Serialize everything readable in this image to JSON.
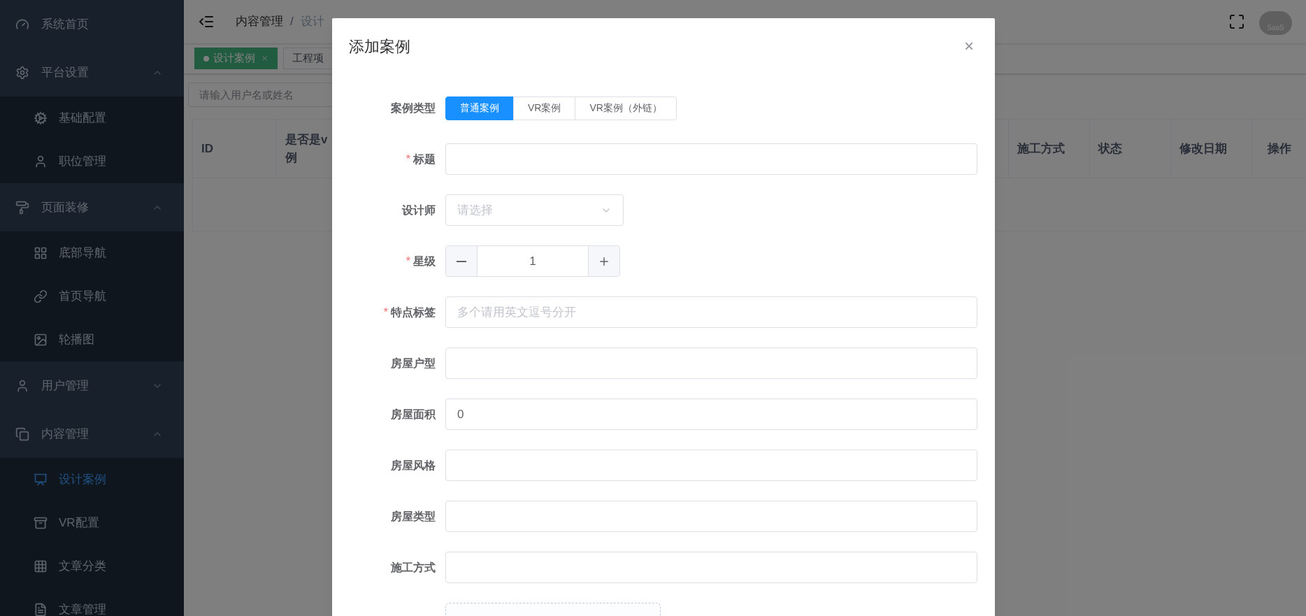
{
  "sidebar": {
    "items": [
      {
        "label": "系统首页",
        "kind": "link",
        "selected": false
      },
      {
        "label": "平台设置",
        "kind": "group",
        "expanded": true,
        "children": [
          {
            "label": "基础配置",
            "selected": false
          },
          {
            "label": "职位管理",
            "selected": false
          }
        ]
      },
      {
        "label": "页面装修",
        "kind": "group",
        "expanded": true,
        "children": [
          {
            "label": "底部导航",
            "selected": false
          },
          {
            "label": "首页导航",
            "selected": false
          },
          {
            "label": "轮播图",
            "selected": false
          }
        ]
      },
      {
        "label": "用户管理",
        "kind": "group",
        "expanded": false
      },
      {
        "label": "内容管理",
        "kind": "group",
        "expanded": true,
        "children": [
          {
            "label": "设计案例",
            "selected": true
          },
          {
            "label": "VR配置",
            "selected": false
          },
          {
            "label": "文章分类",
            "selected": false
          },
          {
            "label": "文章管理",
            "selected": false
          }
        ]
      }
    ]
  },
  "header": {
    "breadcrumb": [
      "内容管理",
      "设计"
    ],
    "separator": "/",
    "avatar_text": "SaaS"
  },
  "tags": [
    {
      "label": "设计案例",
      "selected": true
    },
    {
      "label": "工程项",
      "selected": false
    }
  ],
  "search": {
    "placeholder": "请输入用户名或姓名"
  },
  "table": {
    "columns": [
      {
        "lines": [
          "ID"
        ]
      },
      {
        "lines": [
          "是否是v",
          "例"
        ]
      },
      {
        "lines": [
          "施工方式"
        ]
      },
      {
        "lines": [
          "状态"
        ]
      },
      {
        "lines": [
          "修改日期"
        ]
      },
      {
        "lines": [
          "操作"
        ]
      }
    ]
  },
  "dialog": {
    "title": "添加案例",
    "close": "×",
    "required_mark": "*",
    "fields": [
      {
        "kind": "radio",
        "label": "案例类型",
        "required": false,
        "options": [
          {
            "label": "普通案例",
            "selected": true
          },
          {
            "label": "VR案例",
            "selected": false
          },
          {
            "label": "VR案例（外链）",
            "selected": false
          }
        ]
      },
      {
        "kind": "text",
        "label": "标题",
        "required": true
      },
      {
        "kind": "select",
        "label": "设计师",
        "required": false,
        "placeholder": "请选择"
      },
      {
        "kind": "number",
        "label": "星级",
        "required": true,
        "value": "1"
      },
      {
        "kind": "text",
        "label": "特点标签",
        "required": true,
        "placeholder": "多个请用英文逗号分开"
      },
      {
        "kind": "text",
        "label": "房屋户型",
        "required": false
      },
      {
        "kind": "text",
        "label": "房屋面积",
        "required": false,
        "value": "0"
      },
      {
        "kind": "text",
        "label": "房屋风格",
        "required": false
      },
      {
        "kind": "text",
        "label": "房屋类型",
        "required": false
      },
      {
        "kind": "text",
        "label": "施工方式",
        "required": false
      },
      {
        "kind": "upload",
        "required": false
      }
    ]
  }
}
